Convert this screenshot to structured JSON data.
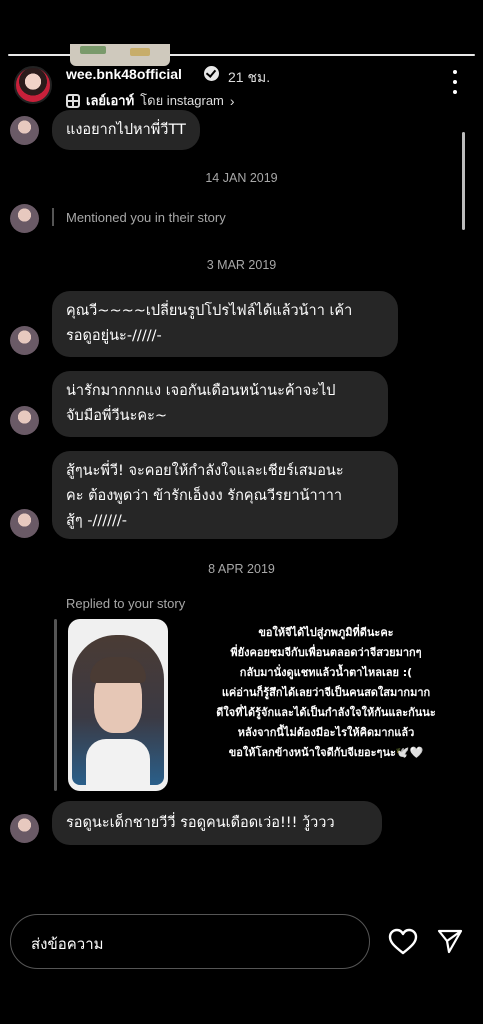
{
  "header": {
    "username": "wee.bnk48official",
    "time": "21 ชม.",
    "layout_label": "เลย์เอาท์",
    "layout_suffix": "โดย instagram",
    "chevron": "›"
  },
  "messages": [
    {
      "text": "แงอยากไปหาพี่วีTT"
    },
    {
      "date": "14 JAN 2019"
    },
    {
      "mention": "Mentioned you in their story"
    },
    {
      "date": "3 MAR 2019"
    },
    {
      "text": "คุณวี~~~~เปลี่ยนรูปโปรไฟล์ได้แล้วน้าา เค้า\nรอดูอยู่นะ-/////-"
    },
    {
      "text": "น่ารักมากกกแง เจอกันเดือนหน้านะค้าจะไป\nจับมือพี่วีนะคะ~"
    },
    {
      "text": "สู้ๆนะพี่วี! จะคอยให้กำลังใจและเชียร์เสมอนะ\nคะ ต้องพูดว่า ข้ารักเอ็งงง รักคุณวีรยาน้าาาา\nสู้ๆ -//////-"
    },
    {
      "date": "8 APR 2019"
    },
    {
      "replied": "Replied to your story"
    },
    {
      "text": "รอดูนะเด็กชายวีวี่ รอดูคนเดือดเว่อ!!! วู้ววว"
    }
  ],
  "story_caption": "ขอให้จีได้ไปสู่ภพภูมิที่ดีนะคะ\nพี่ยังคอยชมจีกับเพื่อนตลอดว่าจีสวยมากๆ\nกลับมานั่งดูแชทแล้วน้ำตาไหลเลย :(\nแค่อ่านก็รู้สึกได้เลยว่าจีเป็นคนสดใสมากมาก\nดีใจที่ได้รู้จักและได้เป็นกำลังใจให้กันและกันนะ\nหลังจากนี้ไม่ต้องมีอะไรให้คิดมากแล้ว\nขอให้โลกข้างหน้าใจดีกับจีเยอะๆนะ🕊️🤍",
  "composer": {
    "placeholder": "ส่งข้อความ"
  },
  "icons": {
    "heart": "heart-icon",
    "send": "send-icon",
    "more": "more-icon",
    "verified": "verified-icon"
  }
}
